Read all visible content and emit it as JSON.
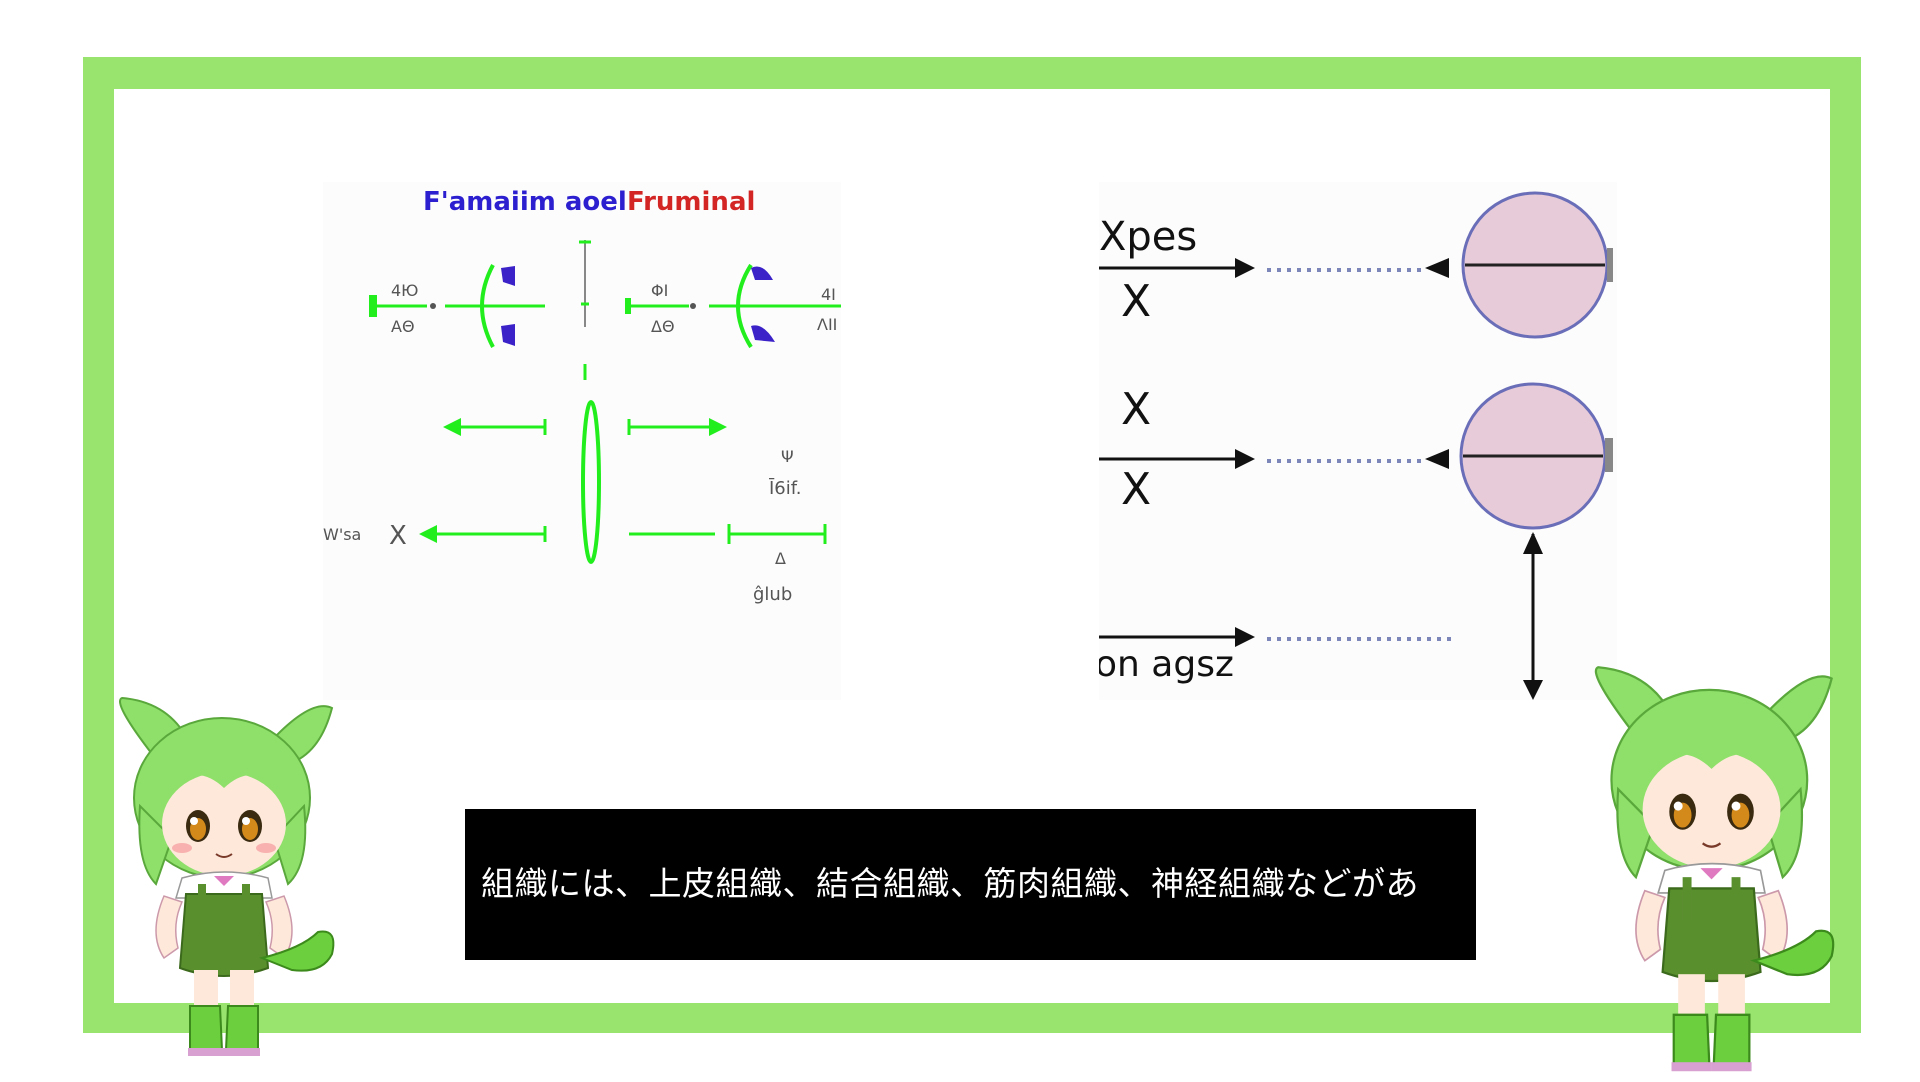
{
  "slide": {
    "frame_color": "#98e46f",
    "caption": "組織には、上皮組織、結合組織、筋肉組織、神経組織などがあ"
  },
  "diagram_left": {
    "title_part1": "F'amaiim aoel",
    "title_part2": "Fruminal",
    "title_color1": "#2b1fd0",
    "title_color2": "#d42525",
    "label_top_left_a": "4Ю",
    "label_top_left_b": "ΑΘ",
    "label_top_right_a": "ΦI",
    "label_top_right_b": "ΔΘ",
    "label_far_right_a": "4I",
    "label_far_right_b": "ΛII",
    "label_bottom_left": "W'sa",
    "label_bottom_left_x": "X",
    "label_right_mid_a": "Ψ",
    "label_right_mid_b": "Ī6if.",
    "label_right_low_a": "Δ",
    "label_right_low_b": "ĝlub",
    "line_color": "#22ee1e",
    "accent_color": "#3a22c8"
  },
  "diagram_right": {
    "label_top": "Xpes",
    "label_x1": "X",
    "label_x2": "X",
    "label_x3": "X",
    "label_bottom": "on agsz",
    "circle_fill": "#e8cbd8",
    "circle_stroke": "#6a6eb8"
  },
  "mascots": {
    "hair_color": "#8ee06a",
    "outfit_color": "#5a8f2e"
  }
}
